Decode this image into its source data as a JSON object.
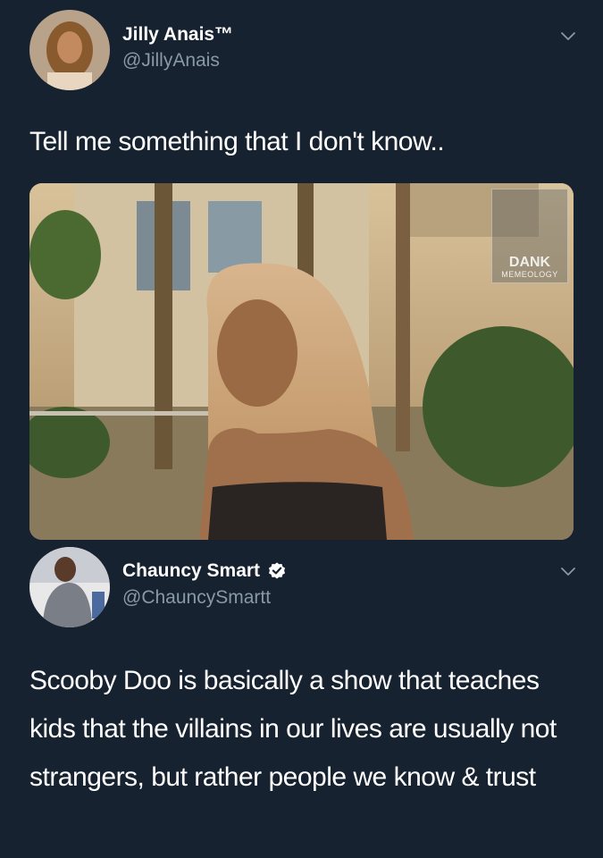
{
  "tweet1": {
    "display_name": "Jilly Anais™",
    "handle": "@JillyAnais",
    "text": "Tell me something that I don't know..",
    "watermark": {
      "line1": "DANK",
      "line2": "MEMEOLOGY"
    }
  },
  "tweet2": {
    "display_name": "Chauncy Smart",
    "handle": "@ChauncySmartt",
    "verified": true,
    "text": "Scooby Doo is basically a show that teaches kids that the villains in our lives are usually not strangers, but rather people we know & trust"
  },
  "colors": {
    "background": "#172230",
    "secondary_text": "#8899a6",
    "verified_badge": "#ffffff"
  }
}
